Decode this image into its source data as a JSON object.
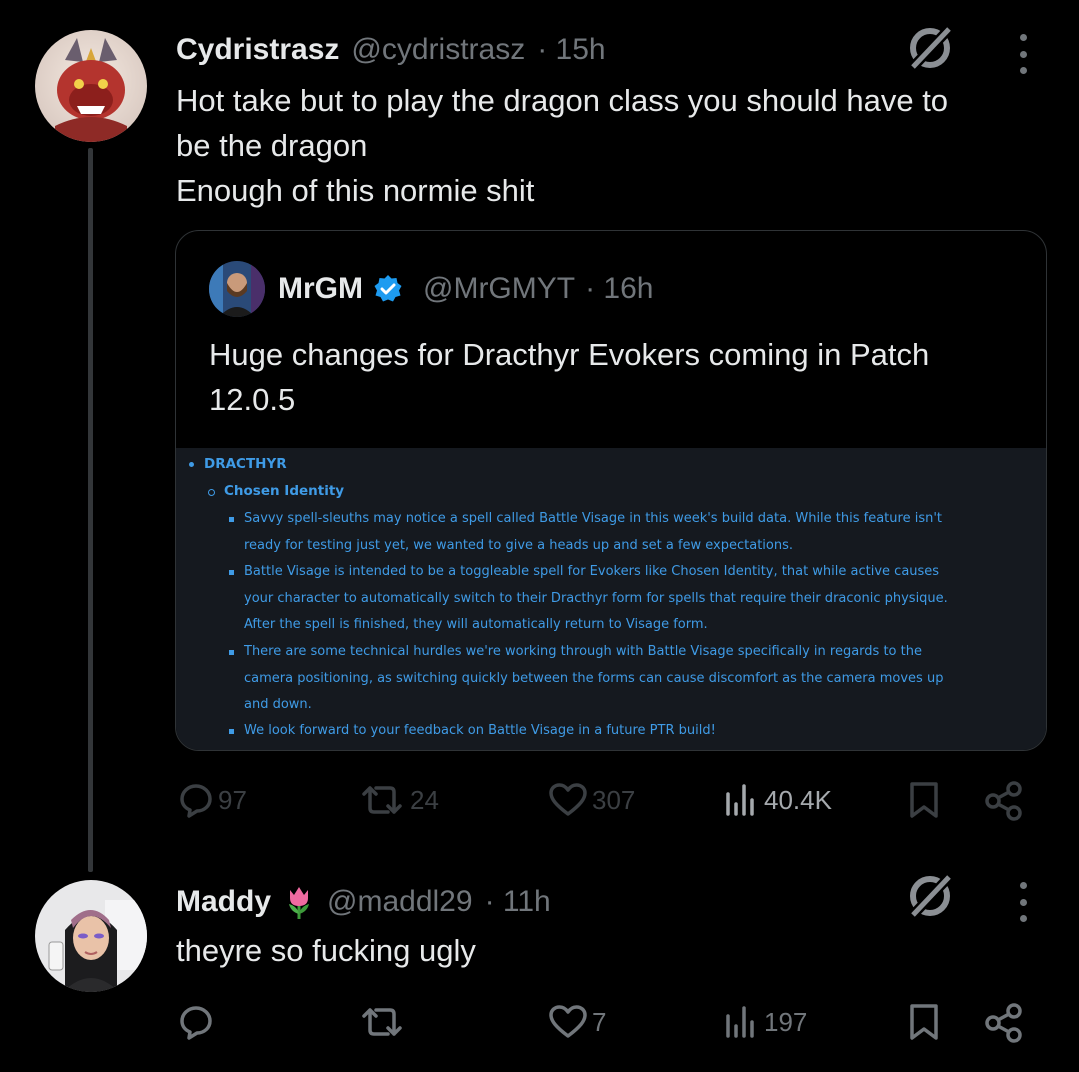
{
  "post1": {
    "name": "Cydristrasz",
    "handle": "@cydristrasz",
    "time": "· 15h",
    "text_lines": [
      "Hot take but to play the dragon class you should have to",
      "be the dragon",
      "Enough of this normie shit"
    ],
    "quote": {
      "name": "MrGM",
      "handle": "@MrGMYT",
      "time": "· 16h",
      "text_lines": [
        "Huge changes for Dracthyr Evokers coming in Patch",
        "12.0.5"
      ],
      "notes": {
        "heading": "DRACTHYR",
        "subheading": "Chosen Identity",
        "bullets": [
          [
            "Savvy spell-sleuths may notice a spell called Battle Visage in this week's build data. While this feature isn't",
            "ready for testing just yet, we wanted to give a heads up and set a few expectations."
          ],
          [
            "Battle Visage is intended to be a toggleable spell for Evokers like Chosen Identity, that while active causes",
            "your character to automatically switch to their Dracthyr form for spells that require their draconic physique.",
            "After the spell is finished, they will automatically return to Visage form."
          ],
          [
            "There are some technical hurdles we're working through with Battle Visage specifically in regards to the",
            "camera positioning, as switching quickly between the forms can cause discomfort as the camera moves up",
            "and down."
          ],
          [
            "We look forward to your feedback on Battle Visage in a future PTR build!"
          ]
        ]
      }
    },
    "actions": {
      "replies": "97",
      "reposts": "24",
      "likes": "307",
      "views": "40.4K"
    }
  },
  "post2": {
    "name": "Maddy",
    "emoji": "🌷",
    "handle": "@maddl29",
    "time": "· 11h",
    "text": "theyre so fucking ugly",
    "actions": {
      "replies": "",
      "reposts": "",
      "likes": "7",
      "views": "197"
    }
  },
  "colors": {
    "background": "#000000",
    "text": "#e7e9ea",
    "muted": "#71767b",
    "notes_bg": "#15191f",
    "notes_text": "#3f9be6",
    "verified": "#1d9bf0"
  },
  "icons": [
    "grok-icon",
    "more-icon",
    "reply-icon",
    "repost-icon",
    "like-icon",
    "views-icon",
    "bookmark-icon",
    "share-icon",
    "verified-badge-icon",
    "tulip-emoji"
  ]
}
